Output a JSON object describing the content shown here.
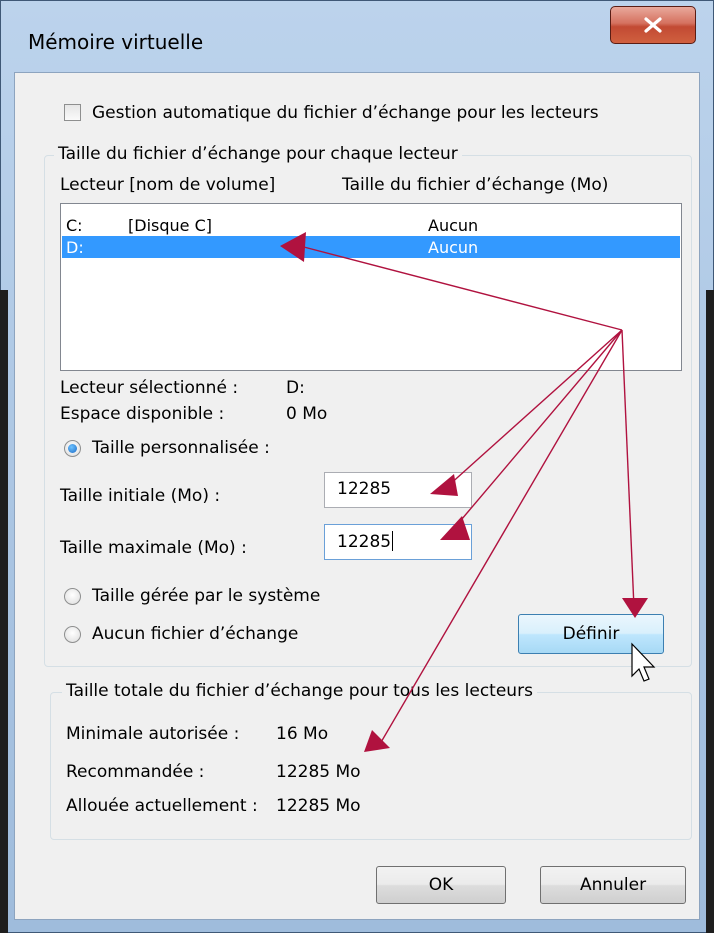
{
  "window": {
    "title": "Mémoire virtuelle",
    "close_icon": "close-icon"
  },
  "auto_manage": {
    "label": "Gestion automatique du fichier d’échange pour les lecteurs",
    "checked": false
  },
  "per_drive_group": {
    "legend": "Taille du fichier d’échange pour chaque lecteur",
    "col_drive": "Lecteur [nom de volume]",
    "col_size": "Taille du fichier d’échange (Mo)",
    "drives": [
      {
        "drive": "C:",
        "volume": "[Disque C]",
        "size": "Aucun",
        "selected": false
      },
      {
        "drive": "D:",
        "volume": "",
        "size": "Aucun",
        "selected": true
      }
    ],
    "selected_drive_label": "Lecteur sélectionné :",
    "selected_drive_value": "D:",
    "free_space_label": "Espace disponible :",
    "free_space_value": "0 Mo",
    "custom_size_label": "Taille personnalisée :",
    "initial_size_label": "Taille initiale (Mo) :",
    "initial_size_value": "12285",
    "max_size_label": "Taille maximale (Mo) :",
    "max_size_value": "12285",
    "system_managed_label": "Taille gérée par le système",
    "no_paging_label": "Aucun fichier d’échange",
    "set_button": "Définir"
  },
  "total_group": {
    "legend": "Taille totale du fichier d’échange pour tous les lecteurs",
    "min_label": "Minimale autorisée :",
    "min_value": "16 Mo",
    "recommended_label": "Recommandée :",
    "recommended_value": "12285 Mo",
    "allocated_label": "Allouée actuellement :",
    "allocated_value": "12285 Mo"
  },
  "footer": {
    "ok_button": "OK",
    "cancel_button": "Annuler"
  },
  "annotation": {
    "arrow_color": "#b0123f"
  }
}
